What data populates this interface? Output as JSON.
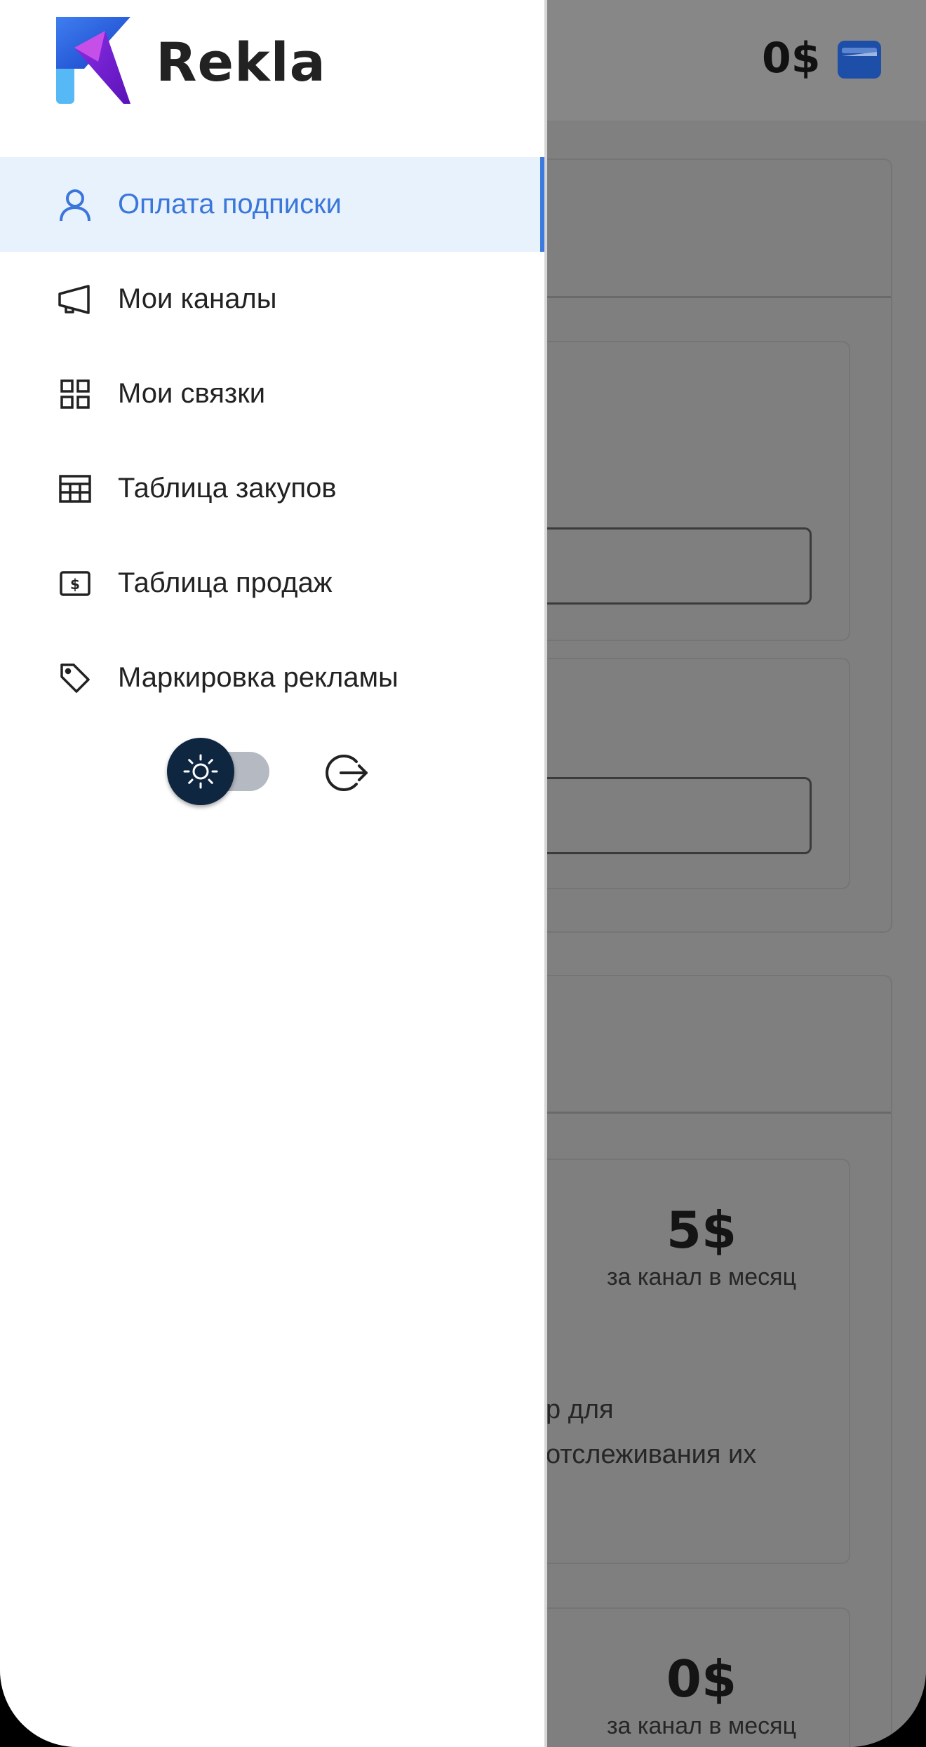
{
  "background": {
    "balance": "0$",
    "text_fragment_1": "р для",
    "text_fragment_2": "отслеживания их",
    "tiers": [
      {
        "price": "5$",
        "period": "за канал в месяц"
      },
      {
        "price": "0$",
        "period": "за канал в месяц"
      }
    ]
  },
  "drawer": {
    "brand": "Rekla",
    "nav": [
      {
        "label": "Оплата подписки",
        "icon": "user-icon",
        "active": true
      },
      {
        "label": "Мои каналы",
        "icon": "megaphone-icon",
        "active": false
      },
      {
        "label": "Мои связки",
        "icon": "grid-icon",
        "active": false
      },
      {
        "label": "Таблица закупов",
        "icon": "table-icon",
        "active": false
      },
      {
        "label": "Таблица продаж",
        "icon": "dollar-bill-icon",
        "active": false
      },
      {
        "label": "Маркировка рекламы",
        "icon": "tag-icon",
        "active": false
      }
    ],
    "theme_toggle": {
      "icon": "sun-icon",
      "state": "light"
    },
    "logout_icon": "logout-icon"
  },
  "colors": {
    "accent": "#3b76da",
    "active_bg": "#e8f2fd",
    "toggle_knob": "#0f2640",
    "wallet": "#1e4fa8"
  }
}
